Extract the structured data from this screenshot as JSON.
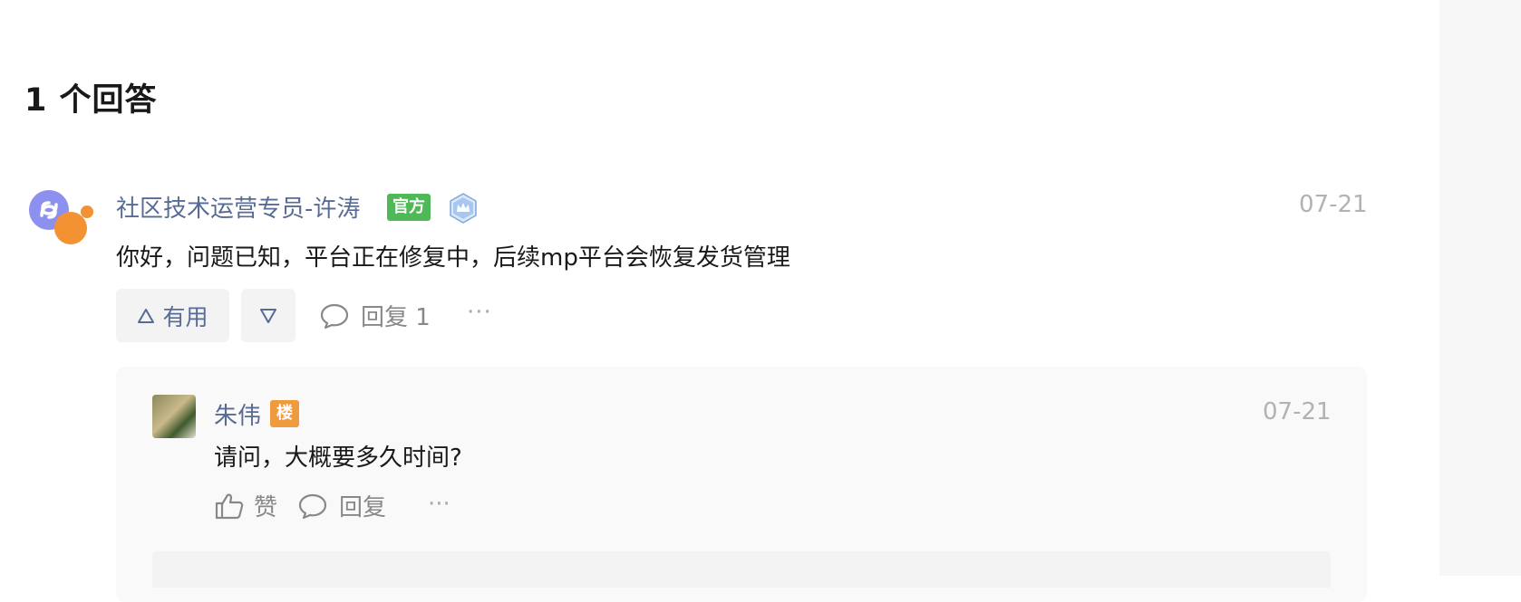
{
  "answers": {
    "title": "1 个回答"
  },
  "answer": {
    "author": "社区技术运营专员-许涛",
    "official_badge": "官方",
    "crown_badge_icon": "crown-badge-icon",
    "date": "07-21",
    "text": "你好，问题已知，平台正在修复中，后续mp平台会恢复发货管理",
    "useful_label": "有用",
    "reply_label": "回复 1",
    "more_label": "···"
  },
  "reply": {
    "author": "朱伟",
    "floor_badge": "楼",
    "date": "07-21",
    "text": "请问，大概要多久时间?",
    "like_label": "赞",
    "reply_label": "回复",
    "more_label": "···"
  },
  "colors": {
    "link": "#576b95",
    "official_badge": "#4fb958",
    "floor_badge": "#f09a3e",
    "muted": "#b2b2b2"
  }
}
